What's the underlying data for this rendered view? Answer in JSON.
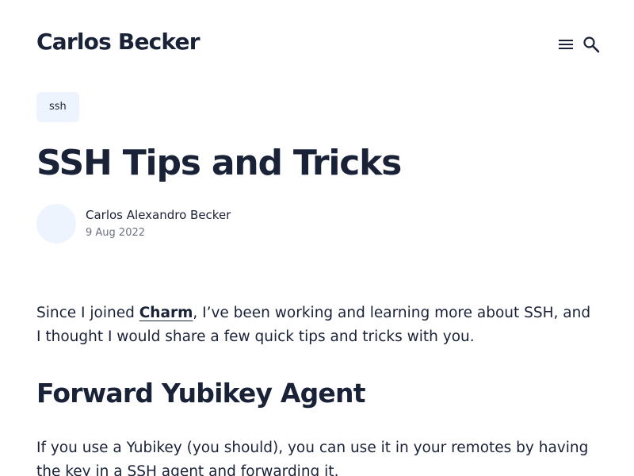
{
  "header": {
    "site_title": "Carlos Becker",
    "icons": [
      "menu-icon",
      "search-icon"
    ]
  },
  "post": {
    "tag": "ssh",
    "title": "SSH Tips and Tricks",
    "author": "Carlos Alexandro Becker",
    "date": "9 Aug 2022",
    "intro_before": "Since I joined ",
    "intro_link": "Charm",
    "intro_after": ", I’ve been working and learning more about SSH, and I thought I would share a few quick tips and tricks with you.",
    "section_heading": "Forward Yubikey Agent",
    "section_paragraph": "If you use a Yubikey (you should), you can use it in your remotes by having the key in a SSH agent and forwarding it."
  },
  "colors": {
    "text": "#1a2238",
    "muted": "#6b7280",
    "tag_bg": "#eef4fd",
    "avatar_bg": "#eef4fd"
  }
}
